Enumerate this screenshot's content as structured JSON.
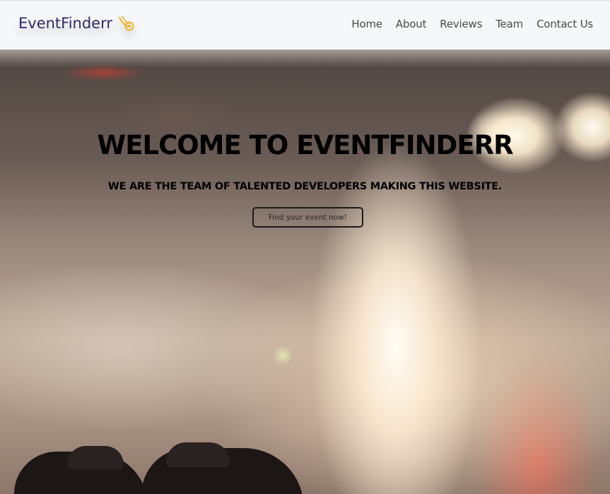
{
  "navbar": {
    "brand": "EventFinderr",
    "brand_icon": "comet-icon",
    "links": [
      {
        "label": "Home"
      },
      {
        "label": "About"
      },
      {
        "label": "Reviews"
      },
      {
        "label": "Team"
      },
      {
        "label": "Contact Us"
      }
    ]
  },
  "hero": {
    "title": "WELCOME TO EVENTFINDERR",
    "subtitle": "WE ARE THE TEAM OF TALENTED DEVELOPERS MAKING THIS WEBSITE.",
    "cta_label": "Find your event now!",
    "background": "blurred-concert-stage-lights-image"
  },
  "colors": {
    "brand_text": "#2c2a6b",
    "brand_icon": "#f2b632",
    "navbar_bg": "#f6f7f9",
    "nav_link": "#4a4a4a",
    "hero_text": "#000000"
  }
}
